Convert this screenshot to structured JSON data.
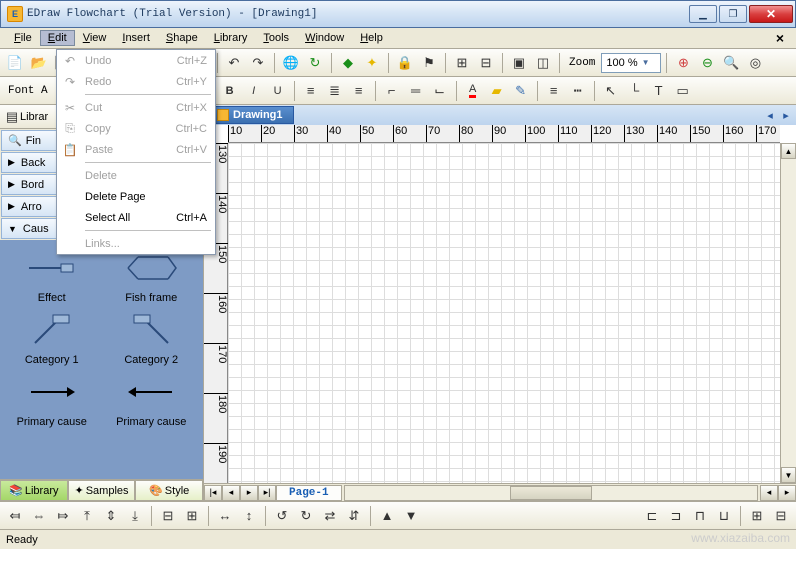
{
  "title": "EDraw Flowchart (Trial Version) - [Drawing1]",
  "menubar": [
    "File",
    "Edit",
    "View",
    "Insert",
    "Shape",
    "Library",
    "Tools",
    "Window",
    "Help"
  ],
  "editmenu": [
    {
      "label": "Undo",
      "shortcut": "Ctrl+Z",
      "disabled": true,
      "icon": "↶"
    },
    {
      "label": "Redo",
      "shortcut": "Ctrl+Y",
      "disabled": true,
      "icon": "↷"
    },
    {
      "sep": true
    },
    {
      "label": "Cut",
      "shortcut": "Ctrl+X",
      "disabled": true,
      "icon": "✂"
    },
    {
      "label": "Copy",
      "shortcut": "Ctrl+C",
      "disabled": true,
      "icon": "⎘"
    },
    {
      "label": "Paste",
      "shortcut": "Ctrl+V",
      "disabled": true,
      "icon": "📋"
    },
    {
      "sep": true
    },
    {
      "label": "Delete",
      "disabled": true
    },
    {
      "label": "Delete Page",
      "disabled": false
    },
    {
      "label": "Select All",
      "shortcut": "Ctrl+A",
      "disabled": false
    },
    {
      "sep": true
    },
    {
      "label": "Links...",
      "disabled": true
    }
  ],
  "zoom": {
    "label": "Zoom",
    "value": "100 %"
  },
  "fontarea_label": "Font A",
  "library_label": "Librar",
  "categories": [
    {
      "label": "Fin",
      "tri": "▶",
      "icon": "🔍"
    },
    {
      "label": "Back",
      "tri": "▶"
    },
    {
      "label": "Bord",
      "tri": "▶"
    },
    {
      "label": "Arro",
      "tri": "▶"
    },
    {
      "label": "Caus",
      "tri": "▼"
    }
  ],
  "shapes": [
    {
      "label": "Effect",
      "svg": "effect"
    },
    {
      "label": "Fish frame",
      "svg": "fish"
    },
    {
      "label": "Category 1",
      "svg": "cat1"
    },
    {
      "label": "Category 2",
      "svg": "cat2"
    },
    {
      "label": "Primary cause",
      "svg": "arrowR"
    },
    {
      "label": "Primary cause",
      "svg": "arrowL"
    }
  ],
  "sidetabs": [
    {
      "label": "Library",
      "icon": "📚",
      "sel": true
    },
    {
      "label": "Samples",
      "icon": "✦"
    },
    {
      "label": "Style",
      "icon": "🎨"
    }
  ],
  "doctab": "Drawing1",
  "ruler_h": [
    10,
    20,
    30,
    40,
    50,
    60,
    70,
    80,
    90,
    100,
    110,
    120,
    130,
    140,
    150,
    160,
    170
  ],
  "ruler_v": [
    130,
    140,
    150,
    160,
    170,
    180,
    190
  ],
  "pagetab": "Page-1",
  "status": "Ready",
  "watermark": "www.xiazaiba.com",
  "colors": {
    "accent": "#3a6fb0",
    "sidebar_bg": "#7e9bc5"
  }
}
